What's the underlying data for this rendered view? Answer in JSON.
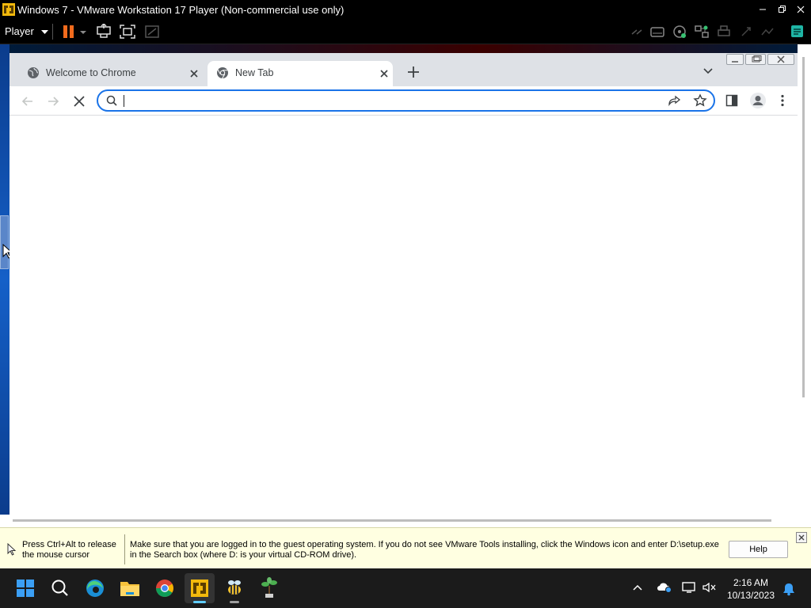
{
  "vmware": {
    "title": "Windows 7 - VMware Workstation 17 Player (Non-commercial use only)",
    "player_menu": "Player"
  },
  "chrome": {
    "tabs": [
      {
        "label": "Welcome to Chrome",
        "icon": "globe-icon",
        "active": false
      },
      {
        "label": "New Tab",
        "icon": "chrome-icon",
        "active": true
      }
    ],
    "omnibox": {
      "value": "",
      "placeholder": ""
    }
  },
  "notice": {
    "cursor_hint": "Press Ctrl+Alt to release the mouse cursor",
    "message": "Make sure that you are logged in to the guest operating system. If you do not see VMware Tools installing, click the Windows icon and enter D:\\setup.exe in the Search box (where D: is your virtual CD-ROM drive).",
    "help_label": "Help"
  },
  "taskbar": {
    "time": "2:16 AM",
    "date": "10/13/2023",
    "apps": [
      "start-icon",
      "search-icon",
      "edge-icon",
      "file-explorer-icon",
      "chrome-icon",
      "vmware-icon",
      "bee-icon",
      "plant-icon"
    ]
  },
  "colors": {
    "accent": "#1a73e8",
    "tabstrip": "#dee1e6",
    "notice_bg": "#ffffe1",
    "taskbar_bg": "#1b1b1b",
    "vmware_pause": "#f26b1d"
  }
}
